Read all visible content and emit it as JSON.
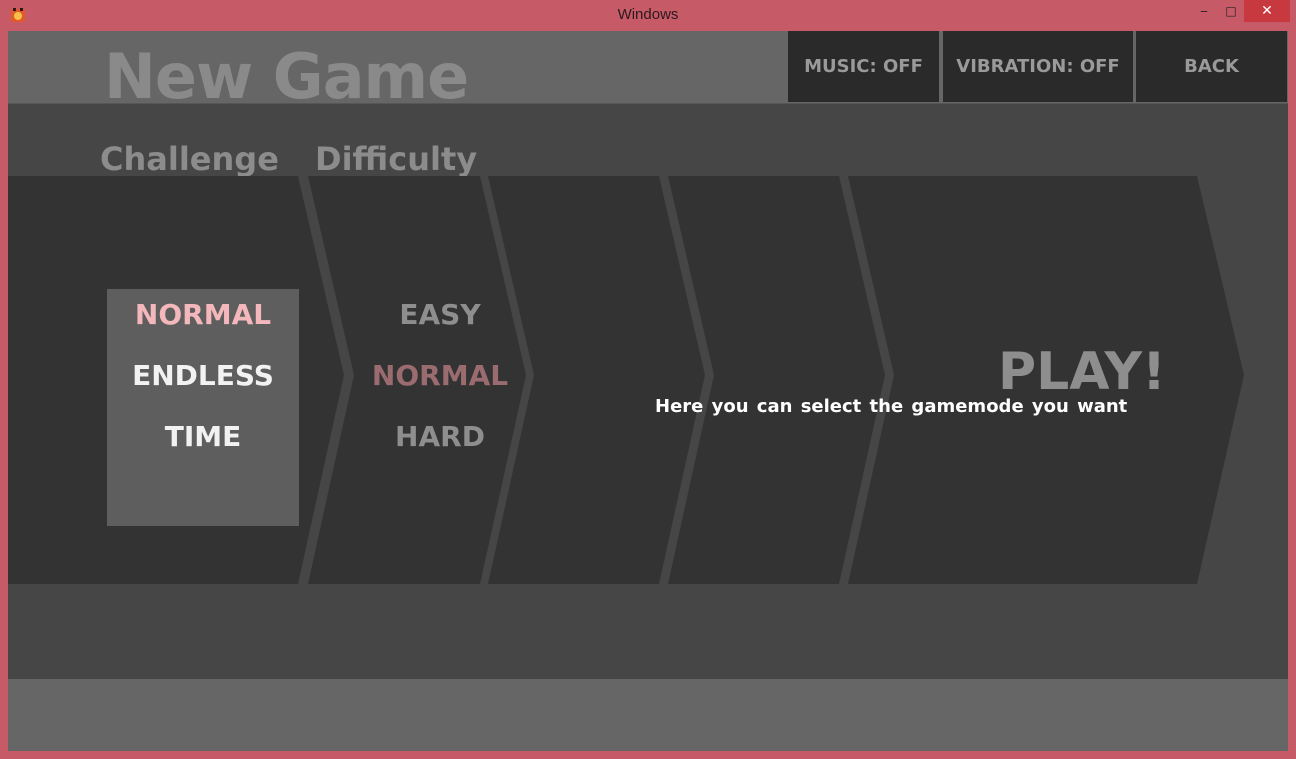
{
  "window": {
    "title": "Windows",
    "minimize_glyph": "‒",
    "maximize_glyph": "□",
    "close_glyph": "✕"
  },
  "header": {
    "title": "New Game",
    "music_label": "MUSIC: OFF",
    "vibration_label": "VIBRATION: OFF",
    "back_label": "BACK"
  },
  "sections": {
    "challenge_label": "Challenge",
    "difficulty_label": "Difficulty"
  },
  "modes": {
    "items": [
      "NORMAL",
      "ENDLESS",
      "TIME"
    ],
    "selected": "NORMAL"
  },
  "difficulty": {
    "items": [
      "EASY",
      "NORMAL",
      "HARD"
    ],
    "selected": "NORMAL"
  },
  "play": {
    "label": "PLAY!",
    "hint": "Here you can select the gamemode you want"
  },
  "colors": {
    "window_frame": "#c65a67",
    "background": "#464646",
    "header_bar": "#666666",
    "chevron": "#333333",
    "selected_mode": "#f4b8bc",
    "selected_difficulty": "#9a6c70",
    "muted_text": "#8e8e8e"
  }
}
